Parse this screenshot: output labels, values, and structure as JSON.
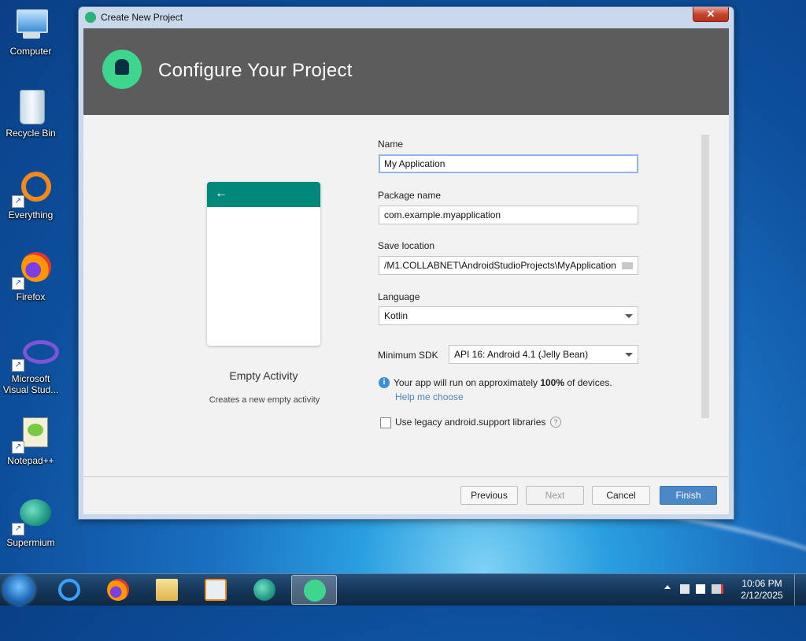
{
  "desktop": {
    "icons": [
      {
        "label": "Computer"
      },
      {
        "label": "Recycle Bin"
      },
      {
        "label": "Everything"
      },
      {
        "label": "Firefox"
      },
      {
        "label": "Microsoft Visual Stud..."
      },
      {
        "label": "Notepad++"
      },
      {
        "label": "Supermium"
      }
    ]
  },
  "window": {
    "title": "Create New Project",
    "close_label": "✕"
  },
  "banner": {
    "title": "Configure Your Project"
  },
  "preview": {
    "back_arrow": "←",
    "activity_name": "Empty Activity",
    "activity_description": "Creates a new empty activity"
  },
  "form": {
    "name_label": "Name",
    "name_value": "My Application",
    "package_label": "Package name",
    "package_value": "com.example.myapplication",
    "save_label": "Save location",
    "save_value": "/M1.COLLABNET\\AndroidStudioProjects\\MyApplication",
    "language_label": "Language",
    "language_value": "Kotlin",
    "min_sdk_label": "Minimum SDK",
    "min_sdk_value": "API 16: Android 4.1 (Jelly Bean)",
    "info_pre": "Your app will run on approximately ",
    "info_bold": "100%",
    "info_post": " of devices.",
    "help_link": "Help me choose",
    "legacy_label": "Use legacy android.support libraries",
    "legacy_checked": false
  },
  "buttons": {
    "previous": "Previous",
    "next": "Next",
    "cancel": "Cancel",
    "finish": "Finish"
  },
  "taskbar": {
    "time": "10:06 PM",
    "date": "2/12/2025"
  },
  "colors": {
    "banner": "#5c5c5c",
    "android_green": "#3dd68c",
    "toolbar_teal": "#00897b",
    "finish_blue": "#4a88c7"
  }
}
